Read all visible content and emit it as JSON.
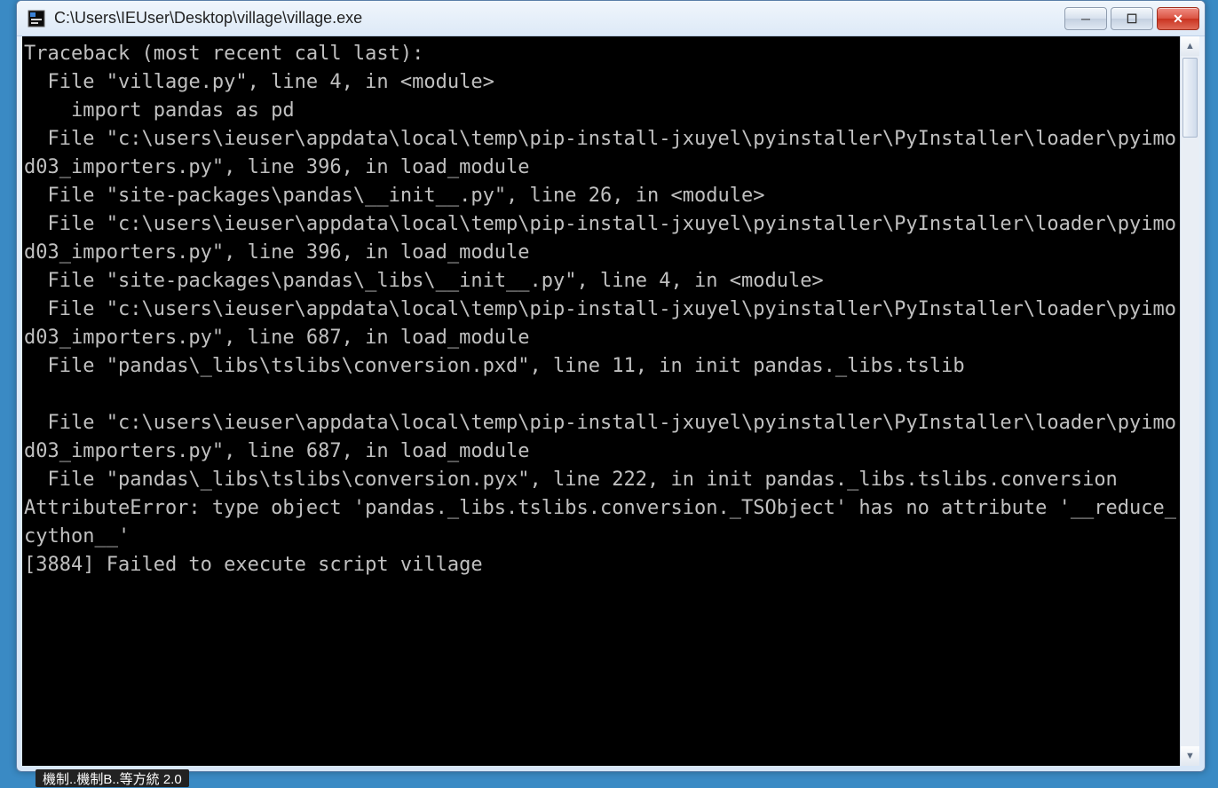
{
  "window": {
    "title": "C:\\Users\\IEUser\\Desktop\\village\\village.exe",
    "icon_name": "app-icon",
    "controls": {
      "minimize_glyph": "─",
      "maximize_glyph": "☐",
      "close_glyph": "✕"
    }
  },
  "console": {
    "lines": [
      "Traceback (most recent call last):",
      "  File \"village.py\", line 4, in <module>",
      "    import pandas as pd",
      "  File \"c:\\users\\ieuser\\appdata\\local\\temp\\pip-install-jxuyel\\pyinstaller\\PyInstaller\\loader\\pyimod03_importers.py\", line 396, in load_module",
      "  File \"site-packages\\pandas\\__init__.py\", line 26, in <module>",
      "  File \"c:\\users\\ieuser\\appdata\\local\\temp\\pip-install-jxuyel\\pyinstaller\\PyInstaller\\loader\\pyimod03_importers.py\", line 396, in load_module",
      "  File \"site-packages\\pandas\\_libs\\__init__.py\", line 4, in <module>",
      "  File \"c:\\users\\ieuser\\appdata\\local\\temp\\pip-install-jxuyel\\pyinstaller\\PyInstaller\\loader\\pyimod03_importers.py\", line 687, in load_module",
      "  File \"pandas\\_libs\\tslibs\\conversion.pxd\", line 11, in init pandas._libs.tslib",
      "",
      "  File \"c:\\users\\ieuser\\appdata\\local\\temp\\pip-install-jxuyel\\pyinstaller\\PyInstaller\\loader\\pyimod03_importers.py\", line 687, in load_module",
      "  File \"pandas\\_libs\\tslibs\\conversion.pyx\", line 222, in init pandas._libs.tslibs.conversion",
      "AttributeError: type object 'pandas._libs.tslibs.conversion._TSObject' has no attribute '__reduce_cython__'",
      "[3884] Failed to execute script village"
    ]
  },
  "scrollbar": {
    "up_glyph": "▲",
    "down_glyph": "▼"
  },
  "taskbar": {
    "fragment": "機制..機制B..等方統       2.0"
  }
}
